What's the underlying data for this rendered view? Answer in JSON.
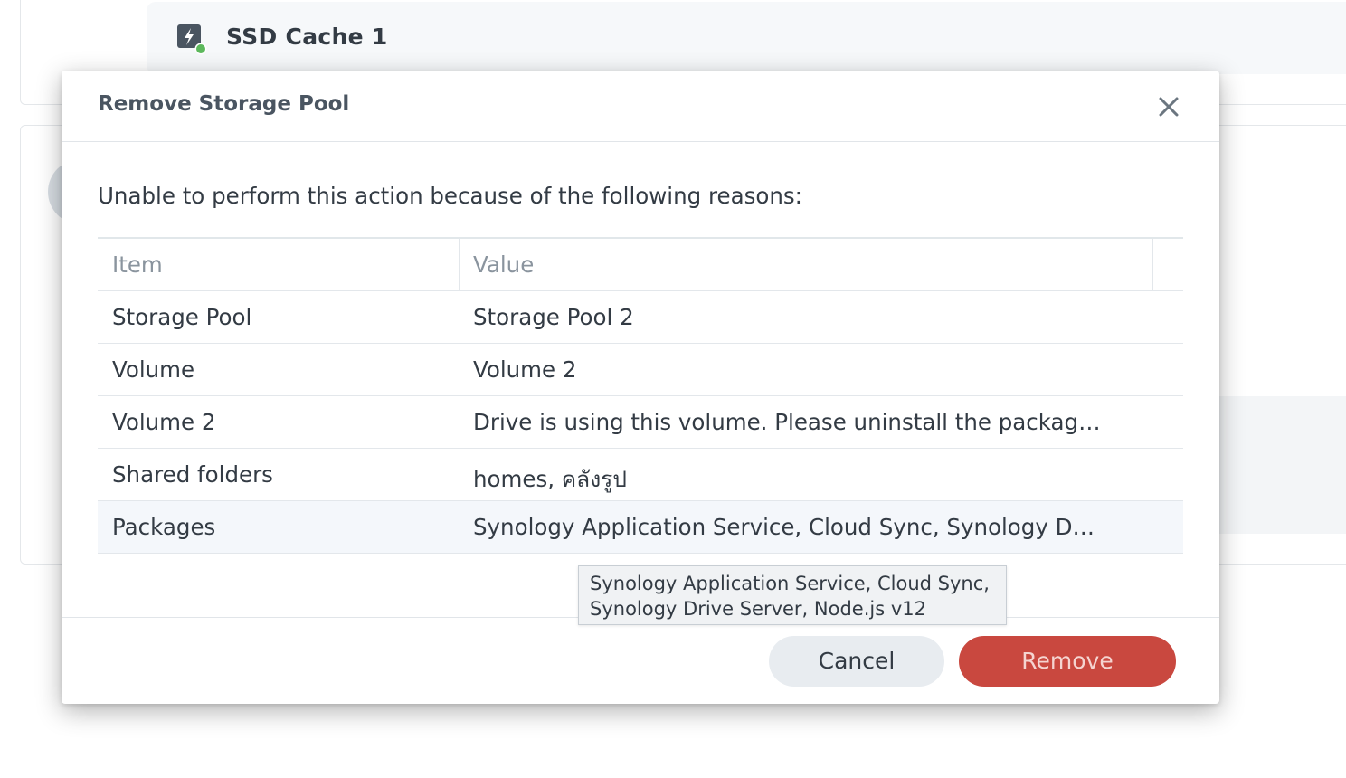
{
  "background": {
    "card_title": "SSD Cache 1",
    "card_icon": "ssd-cache-icon",
    "status_color": "#5cb85c"
  },
  "dialog": {
    "title": "Remove Storage Pool",
    "close_icon": "close-icon",
    "message": "Unable to perform this action because of the following reasons:",
    "table": {
      "headers": [
        "Item",
        "Value"
      ],
      "rows": [
        {
          "item": "Storage Pool",
          "value": "Storage Pool 2"
        },
        {
          "item": "Volume",
          "value": "Volume 2"
        },
        {
          "item": "Volume 2",
          "value": "Drive is using this volume. Please uninstall the packag…"
        },
        {
          "item": "Shared folders",
          "value": "homes, คลังรูป"
        },
        {
          "item": "Packages",
          "value": "Synology Application Service, Cloud Sync, Synology D…"
        }
      ]
    },
    "tooltip": {
      "line1": "Synology Application Service, Cloud Sync,",
      "line2": "Synology Drive Server, Node.js v12"
    },
    "buttons": {
      "cancel": "Cancel",
      "remove": "Remove"
    },
    "colors": {
      "remove_button": "#c9483f",
      "cancel_button": "#e8ecf0"
    }
  }
}
